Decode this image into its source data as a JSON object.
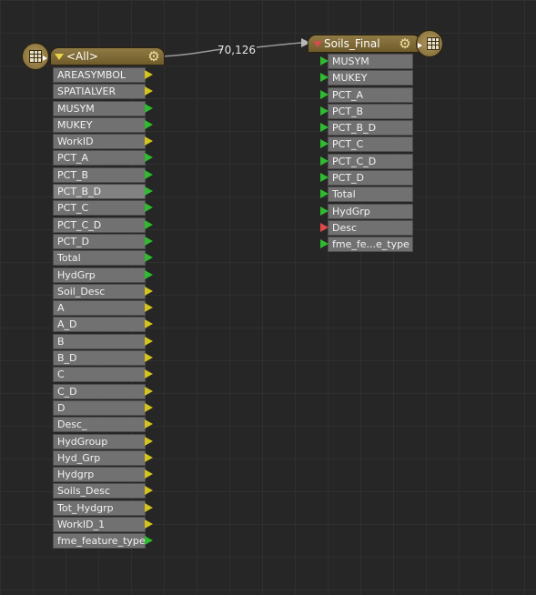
{
  "canvas": {
    "background": "#262626",
    "grid_color": "#2f2f2f"
  },
  "connection": {
    "count": "70,126"
  },
  "reader": {
    "title": "<All>",
    "badge_icon": "table-output-icon",
    "settings_icon": "gear-icon",
    "attributes": [
      {
        "label": "AREASYMBOL",
        "port": "yellow"
      },
      {
        "label": "SPATIALVER",
        "port": "yellow"
      },
      {
        "label": "MUSYM",
        "port": "green"
      },
      {
        "label": "MUKEY",
        "port": "green"
      },
      {
        "label": "WorkID",
        "port": "yellow"
      },
      {
        "label": "PCT_A",
        "port": "green"
      },
      {
        "label": "PCT_B",
        "port": "green"
      },
      {
        "label": "PCT_B_D",
        "port": "green",
        "highlighted": true
      },
      {
        "label": "PCT_C",
        "port": "green"
      },
      {
        "label": "PCT_C_D",
        "port": "green"
      },
      {
        "label": "PCT_D",
        "port": "green"
      },
      {
        "label": "Total",
        "port": "green"
      },
      {
        "label": "HydGrp",
        "port": "green"
      },
      {
        "label": "Soil_Desc",
        "port": "yellow"
      },
      {
        "label": "A",
        "port": "yellow"
      },
      {
        "label": "A_D",
        "port": "yellow"
      },
      {
        "label": "B",
        "port": "yellow"
      },
      {
        "label": "B_D",
        "port": "yellow"
      },
      {
        "label": "C",
        "port": "yellow"
      },
      {
        "label": "C_D",
        "port": "yellow"
      },
      {
        "label": "D",
        "port": "yellow"
      },
      {
        "label": "Desc_",
        "port": "yellow"
      },
      {
        "label": "HydGroup",
        "port": "yellow"
      },
      {
        "label": "Hyd_Grp",
        "port": "yellow"
      },
      {
        "label": "Hydgrp",
        "port": "yellow"
      },
      {
        "label": "Soils_Desc",
        "port": "yellow"
      },
      {
        "label": "Tot_Hydgrp",
        "port": "yellow"
      },
      {
        "label": "WorkID_1",
        "port": "yellow"
      },
      {
        "label": "fme_feature_type",
        "port": "green"
      }
    ]
  },
  "writer": {
    "title": "Soils_Final",
    "badge_icon": "table-input-icon",
    "settings_icon": "gear-icon",
    "attributes": [
      {
        "label": "MUSYM",
        "port": "green"
      },
      {
        "label": "MUKEY",
        "port": "green"
      },
      {
        "label": "PCT_A",
        "port": "green"
      },
      {
        "label": "PCT_B",
        "port": "green"
      },
      {
        "label": "PCT_B_D",
        "port": "green"
      },
      {
        "label": "PCT_C",
        "port": "green"
      },
      {
        "label": "PCT_C_D",
        "port": "green"
      },
      {
        "label": "PCT_D",
        "port": "green"
      },
      {
        "label": "Total",
        "port": "green"
      },
      {
        "label": "HydGrp",
        "port": "green"
      },
      {
        "label": "Desc",
        "port": "red"
      },
      {
        "label": "fme_fe...e_type",
        "port": "green"
      }
    ]
  }
}
